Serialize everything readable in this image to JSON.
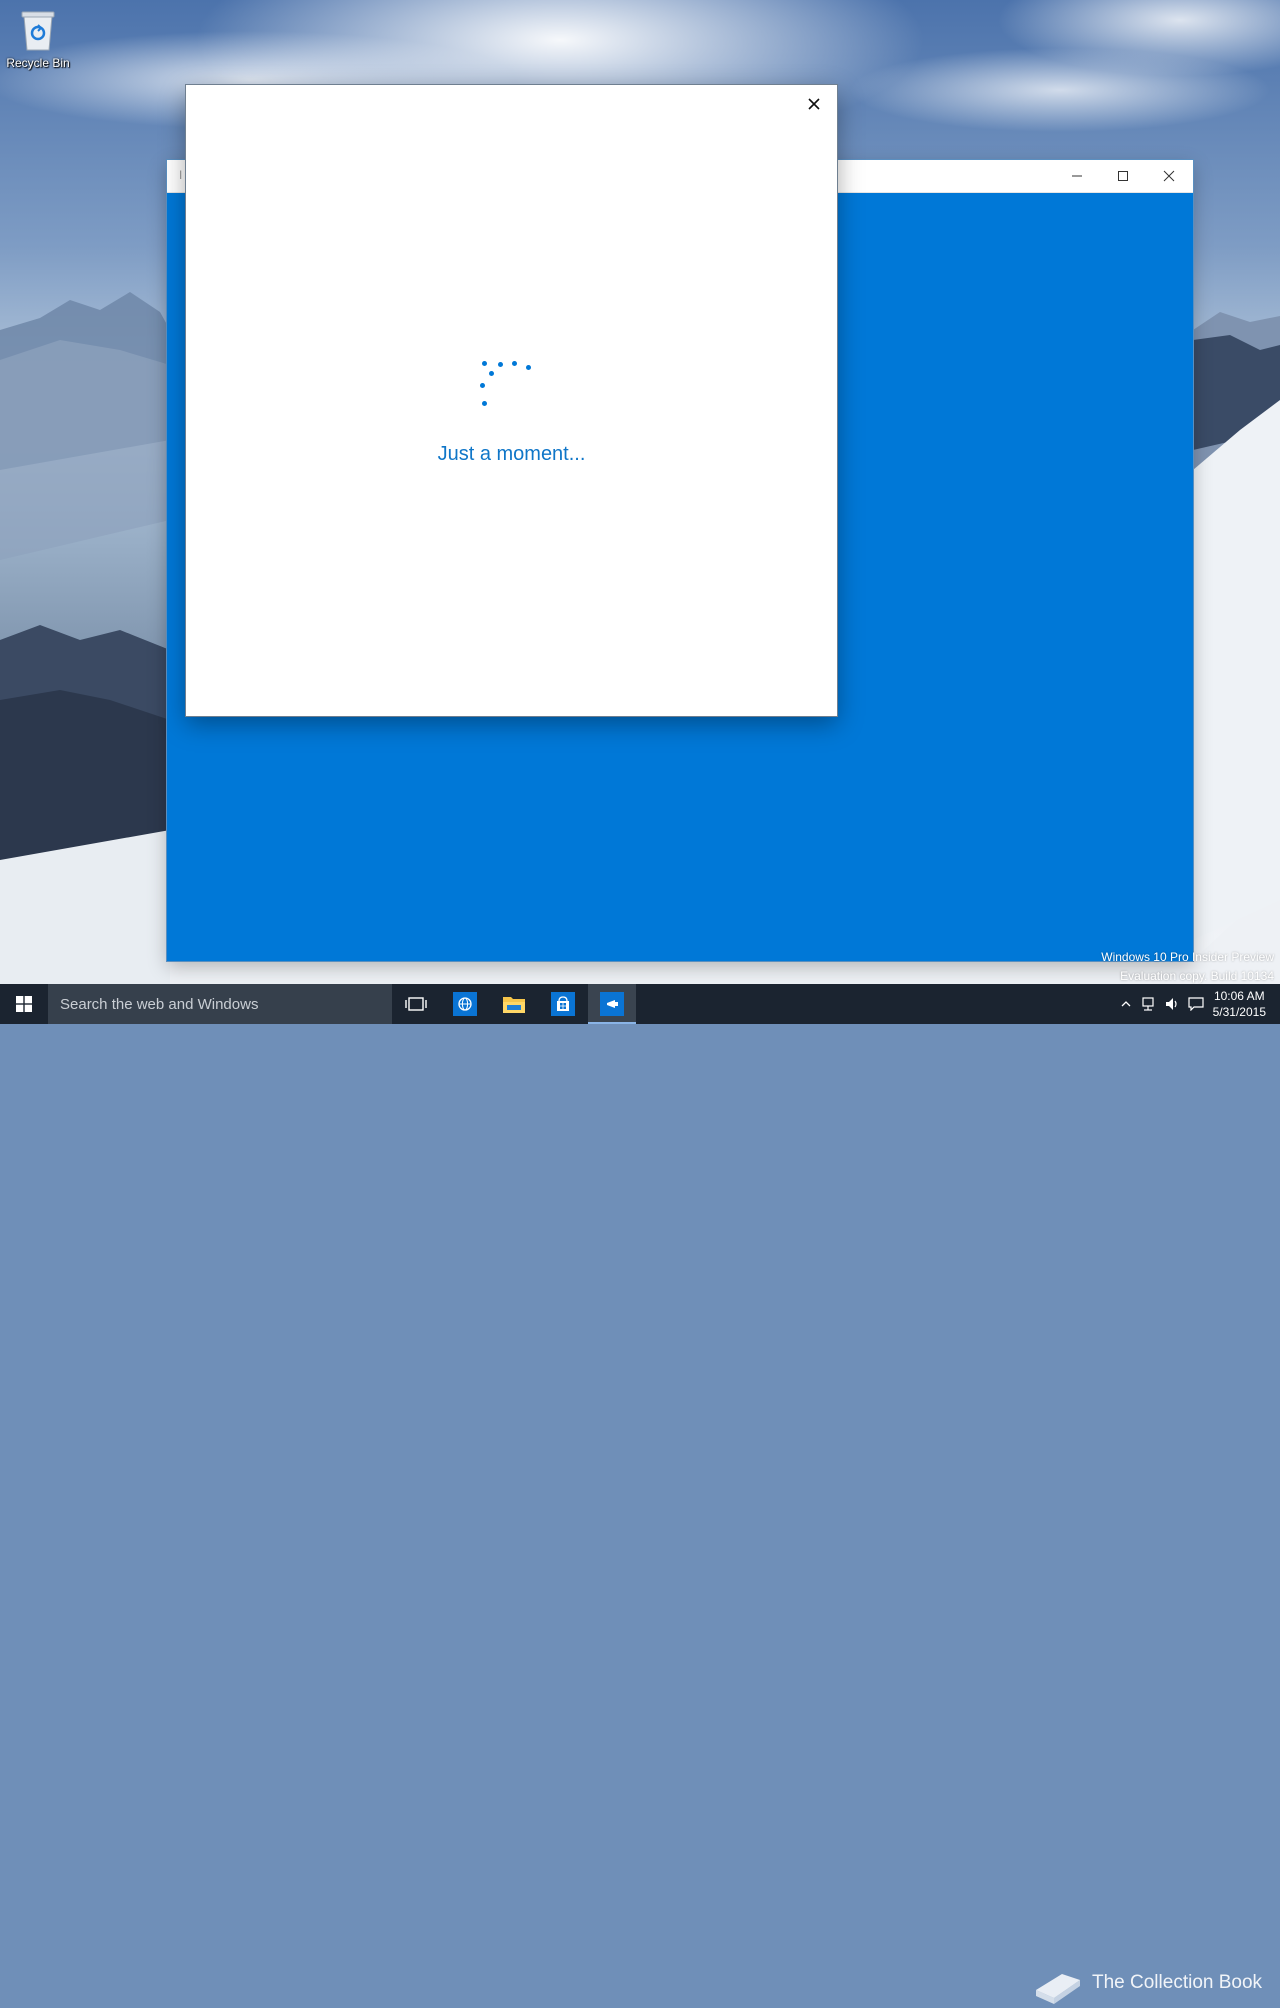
{
  "desktop": {
    "icons": [
      {
        "label": "Recycle Bin",
        "icon": "recycle-bin-icon"
      }
    ]
  },
  "background_window": {
    "title": "I",
    "accent": "#0078d7",
    "controls": {
      "minimize": "minimize-icon",
      "maximize": "maximize-icon",
      "close": "close-icon"
    }
  },
  "dialog": {
    "loading_text": "Just a moment...",
    "spinner_color": "#0078d7",
    "close": "close-icon"
  },
  "watermark": {
    "line1": "Windows 10 Pro Insider Preview",
    "line2": "Evaluation copy. Build 10134",
    "brand": "The Collection Book"
  },
  "taskbar": {
    "search_placeholder": "Search the web and Windows",
    "items": [
      {
        "name": "task-view",
        "icon": "task-view-icon"
      },
      {
        "name": "edge",
        "icon": "globe-icon"
      },
      {
        "name": "file-explorer",
        "icon": "folder-icon"
      },
      {
        "name": "store",
        "icon": "store-icon"
      },
      {
        "name": "insider-app",
        "icon": "insider-icon",
        "active": true
      }
    ],
    "clock": {
      "time": "10:06 AM",
      "date": "5/31/2015"
    }
  }
}
